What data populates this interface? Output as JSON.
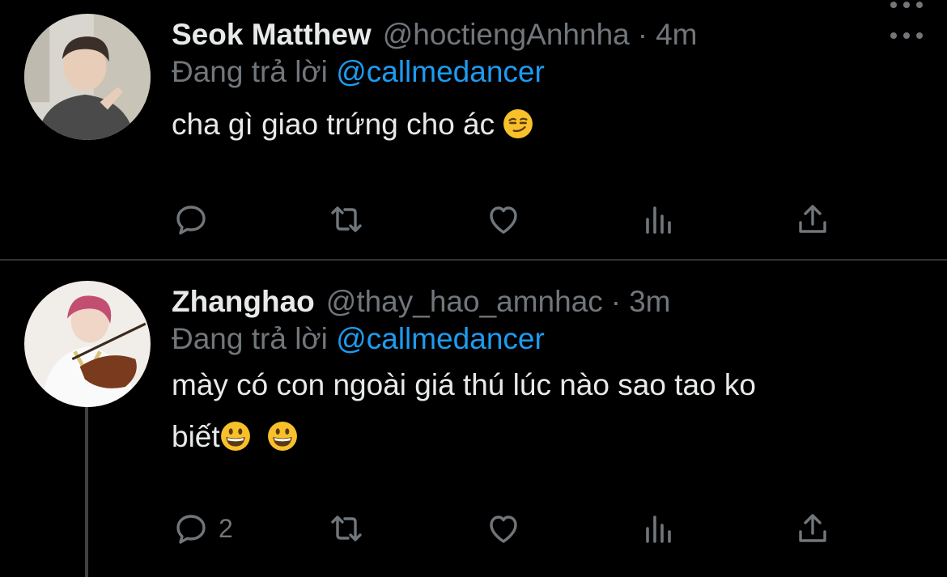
{
  "tweets": [
    {
      "name": "Seok Matthew",
      "handle": "@hoctiengAnhnha",
      "separator": "·",
      "time": "4m",
      "reply_prefix": "Đang trả lời",
      "reply_to": "@callmedancer",
      "text": "cha gì giao trứng cho ác",
      "text_emoji": "smirking-face",
      "counts": {
        "reply": "",
        "retweet": "",
        "like": "",
        "views": ""
      }
    },
    {
      "name": "Zhanghao",
      "handle": "@thay_hao_amnhac",
      "separator": "·",
      "time": "3m",
      "reply_prefix": "Đang trả lời",
      "reply_to": "@callmedancer",
      "text_line1": "mày có con ngoài giá thú lúc nào sao tao ko",
      "text_line2": "biết",
      "text_emoji": "grinning-face",
      "counts": {
        "reply": "2",
        "retweet": "",
        "like": "",
        "views": ""
      }
    }
  ],
  "colors": {
    "background": "#000000",
    "primary_text": "#e7e9ea",
    "secondary_text": "#71767b",
    "mention": "#1d9bf0",
    "divider": "#2f3336"
  },
  "icons": [
    "reply-icon",
    "retweet-icon",
    "like-icon",
    "views-icon",
    "share-icon",
    "more-icon"
  ]
}
